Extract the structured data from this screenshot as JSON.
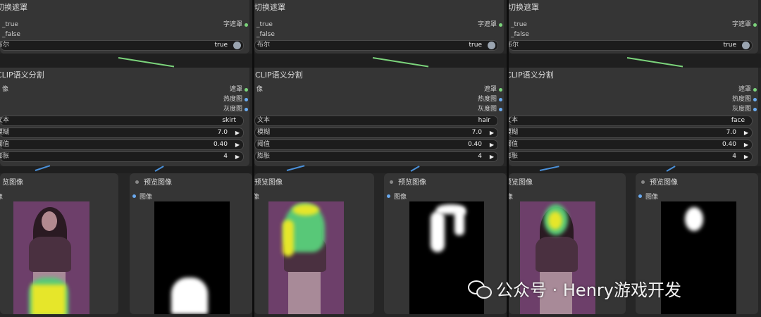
{
  "switch_node": {
    "title": "切换遮罩",
    "input_true": "_true",
    "input_false": "_false",
    "output": "字遮罩",
    "bool_label": "布尔",
    "bool_value": "true"
  },
  "clip_node": {
    "title": "CLIP语义分割",
    "input_image": "像",
    "outputs": [
      "遮罩",
      "热度图",
      "灰度图"
    ],
    "fields": {
      "text_label": "文本",
      "blur_label": "模糊",
      "threshold_label": "阈值",
      "dilate_label": "膨胀"
    }
  },
  "preview_node": {
    "title": "预览图像",
    "port": "图像",
    "left_title": "预览图像",
    "left_port": "像"
  },
  "panels": [
    {
      "text": "skirt",
      "blur": "7.0",
      "threshold": "0.40",
      "dilate": "4",
      "left_title": "览图像"
    },
    {
      "text": "hair",
      "blur": "7.0",
      "threshold": "0.40",
      "dilate": "4",
      "left_title": "预览图像"
    },
    {
      "text": "face",
      "blur": "7.0",
      "threshold": "0.40",
      "dilate": "4",
      "left_title": "预览图像"
    }
  ],
  "panel_prefixes": [
    {
      "switch_title": "切换遮罩",
      "bool": "布尔",
      "clip": "CLIP语义分割",
      "text": "文本",
      "blur": "模糊",
      "threshold": "阈值",
      "dilate": "膨胀"
    },
    {
      "switch_title": "切换遮罩",
      "bool": "布尔",
      "clip": "CLIP语义分割",
      "text": "文本",
      "blur": "模糊",
      "threshold": "阈值",
      "dilate": "膨胀"
    },
    {
      "switch_title": "切换遮罩",
      "bool": "布尔",
      "clip": "CLIP语义分割",
      "text": "文本",
      "blur": "模糊",
      "threshold": "阈值",
      "dilate": "膨胀"
    }
  ],
  "watermark": {
    "text": "公众号 · Henry游戏开发",
    "icon": "wechat-icon"
  },
  "colors": {
    "wire_green": "#7bd37b",
    "wire_blue": "#4a90d9",
    "heat_yellow": "#e6e62a",
    "heat_green": "#58c878"
  }
}
